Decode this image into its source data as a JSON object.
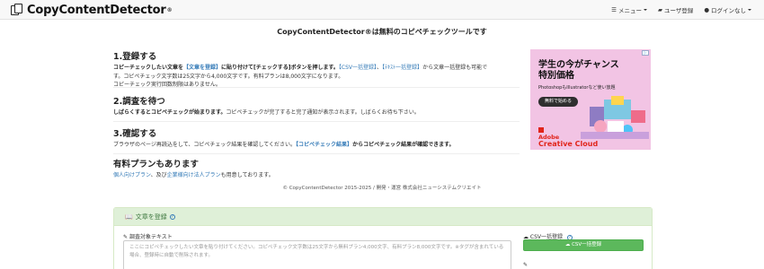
{
  "navbar": {
    "brand": "CopyContentDetector",
    "brand_reg": "®",
    "menu_label": "メニュー",
    "register_label": "ユーザ登録",
    "login_label": "ログインなし"
  },
  "headline": "CopyContentDetector®は無料のコピペチェックツールです",
  "steps": {
    "s1": {
      "title": "1.登録する",
      "l1_a": "コピーチェックしたい文章を",
      "l1_link": "【文章を登録】",
      "l1_b": "に貼り付けて[チェックする]ボタンを押します。",
      "l1_csv": "【CSV一括登録】",
      "l1_sep": "、",
      "l1_text": "【ﾃｷｽﾄ一括登録】",
      "l1_c": "から文章一括登録も可能で",
      "l2": "す。コピペチェック文字数は25文字から4,000文字です。有料プランは8,000文字になります。",
      "l3": "コピーチェック実行回数制限はありません。"
    },
    "s2": {
      "title": "2.調査を待つ",
      "bold": "しばらくするとコピペチェックが始まります。",
      "rest": "コピペチェックが完了すると完了通知が表示されます。しばらくお待ち下さい。"
    },
    "s3": {
      "title": "3.確認する",
      "a": "ブラウザのページ再読込をして、コピペチェック結果を確認してください。",
      "link": "【コピペチェック結果】",
      "b": "からコピペチェック結果が確認できます。"
    },
    "s4": {
      "title": "有料プランもあります",
      "link1": "個人向けプラン",
      "mid": "、及び",
      "link2": "企業様向け法人プラン",
      "end": "も用意しております。"
    }
  },
  "ad": {
    "badge": "▷",
    "title_l1": "学生の今がチャンス",
    "title_l2": "特別価格",
    "sub": "PhotoshopもIllustratorなど使い放題",
    "button": "無料で始める",
    "brand_l1": "Adobe",
    "brand_l2": "Creative Cloud"
  },
  "footer": "© CopyContentDetector 2015-2025 / 開発・運営 株式会社ニューシステムクリエイト",
  "panel": {
    "heading": "文章を登録",
    "help": "?",
    "text_label": "調査対象テキスト",
    "placeholder": "ここにコピペチェックしたい文章を貼り付けてください。コピペチェック文字数は25文字から無料プラン4,000文字、有料プラン8,000文字です。※タグが含まれている場合、登録時に自動で削除されます。",
    "csv_label": "CSV一括登録",
    "csv_button": "CSV一括登録"
  },
  "icons": {
    "menu": "bars-icon",
    "folder": "folder-icon",
    "user": "user-icon",
    "book": "book-icon",
    "edit": "edit-icon",
    "upload": "cloud-upload-icon"
  }
}
